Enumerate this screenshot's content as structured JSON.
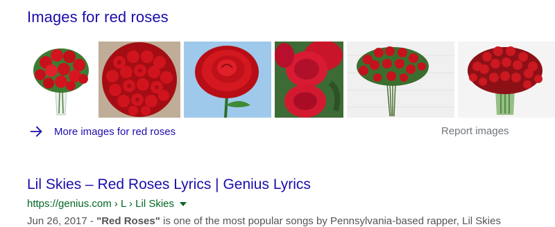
{
  "images_section": {
    "title": "Images for red roses",
    "thumbnails": [
      {
        "alt": "red rose bouquet in vase"
      },
      {
        "alt": "dome of red roses"
      },
      {
        "alt": "single red rose close-up"
      },
      {
        "alt": "red rose buds"
      },
      {
        "alt": "long stem red rose bouquet"
      },
      {
        "alt": "red roses in glass vase"
      }
    ],
    "more_label": "More images for red roses",
    "report_label": "Report images"
  },
  "result": {
    "title": "Lil Skies – Red Roses Lyrics | Genius Lyrics",
    "url": "https://genius.com › L › Lil Skies",
    "snippet_date": "Jun 26, 2017 - ",
    "snippet_bold": "\"Red Roses\"",
    "snippet_text": " is one of the most popular songs by Pennsylvania-based rapper, Lil Skies"
  },
  "colors": {
    "link": "#1a0dab",
    "url_green": "#006621",
    "muted": "#70757a"
  }
}
